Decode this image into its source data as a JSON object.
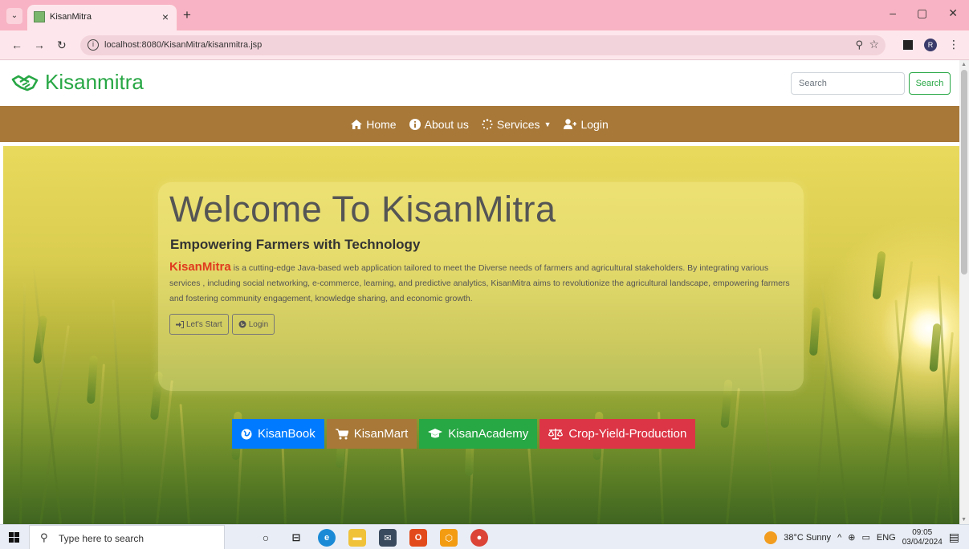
{
  "browser": {
    "tab_title": "KisanMitra",
    "tab_close": "×",
    "new_tab": "+",
    "url": "localhost:8080/KisanMitra/kisanmitra.jsp",
    "window_controls": [
      "–",
      "▢",
      "✕"
    ]
  },
  "header": {
    "brand": "Kisanmitra",
    "search_placeholder": "Search",
    "search_button": "Search"
  },
  "nav": {
    "items": [
      {
        "label": "Home",
        "icon": "home-icon"
      },
      {
        "label": "About us",
        "icon": "info-icon"
      },
      {
        "label": "Services",
        "icon": "spinner-icon",
        "dropdown": true
      },
      {
        "label": "Login",
        "icon": "user-plus-icon"
      }
    ]
  },
  "hero": {
    "title": "Welcome To KisanMitra",
    "subtitle": "Empowering Farmers with Technology",
    "brand_inline": "KisanMitra",
    "description": " is a cutting-edge Java-based web application tailored to meet the Diverse needs of farmers and agricultural stakeholders. By integrating various services , including social networking, e-commerce, learning, and predictive analytics, KisanMitra aims to revolutionize the agricultural landscape, empowering farmers and fostering community engagement, knowledge sharing, and economic growth.",
    "start_button": "Let's Start",
    "login_button": "Login"
  },
  "modules": [
    {
      "label": "KisanBook",
      "icon": "globe-icon",
      "color": "#007bff"
    },
    {
      "label": "KisanMart",
      "icon": "cart-icon",
      "color": "#a77838"
    },
    {
      "label": "KisanAcademy",
      "icon": "graduation-cap-icon",
      "color": "#28a745"
    },
    {
      "label": "Crop-Yield-Production",
      "icon": "balance-scale-icon",
      "color": "#dc3545"
    }
  ],
  "taskbar": {
    "search_placeholder": "Type here to search",
    "weather": "38°C  Sunny",
    "language": "ENG",
    "time": "09:05",
    "date": "03/04/2024"
  },
  "colors": {
    "brand_green": "#28a745",
    "nav_brown": "#a77838",
    "tab_pink": "#f8b4c4"
  }
}
